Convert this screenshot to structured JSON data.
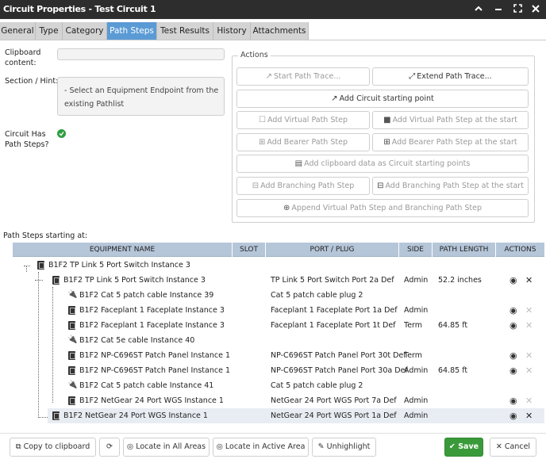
{
  "window": {
    "title": "Circuit Properties - Test Circuit 1",
    "controls": [
      "chevron-up-icon",
      "minimize-icon",
      "expand-icon",
      "close-icon"
    ]
  },
  "tabs": [
    {
      "label": "General",
      "active": false
    },
    {
      "label": "Type",
      "active": false
    },
    {
      "label": "Category",
      "active": false
    },
    {
      "label": "Path Steps",
      "active": true
    },
    {
      "label": "Test Results",
      "active": false
    },
    {
      "label": "History",
      "active": false
    },
    {
      "label": "Attachments",
      "active": false
    }
  ],
  "left": {
    "clipboard_label_1": "Clipboard",
    "clipboard_label_2": "content:",
    "clipboard_value": "",
    "hint_label": "Section / Hint:",
    "hint_text": "- Select an Equipment Endpoint from the existing Pathlist",
    "has_steps_label_1": "Circuit Has",
    "has_steps_label_2": "Path Steps?",
    "has_steps": true
  },
  "actions": {
    "legend": "Actions",
    "start_trace": "Start Path Trace...",
    "extend_trace": "Extend Path Trace...",
    "add_start": "Add Circuit starting point",
    "add_virtual": "Add Virtual Path Step",
    "add_virtual_start": "Add Virtual Path Step at the start",
    "add_bearer": "Add Bearer Path Step",
    "add_bearer_start": "Add Bearer Path Step at the start",
    "add_clipboard": "Add clipboard data as Circuit starting points",
    "add_branching": "Add Branching Path Step",
    "add_branching_start": "Add Branching Path Step at the start",
    "append_virtual_branching": "Append Virtual Path Step and Branching Path Step"
  },
  "path_steps": {
    "label": "Path Steps starting at:",
    "columns": [
      "EQUIPMENT NAME",
      "SLOT",
      "PORT / PLUG",
      "SIDE",
      "PATH LENGTH",
      "ACTIONS"
    ],
    "rows": [
      {
        "name": "B1F2 TP Link 5 Port Switch Instance 3",
        "port": "",
        "side": "",
        "length": "",
        "kind": "equipment",
        "level": 0,
        "actions": false
      },
      {
        "name": "B1F2 TP Link 5 Port Switch Instance 3",
        "port": "TP Link 5 Port Switch Port 2a Def",
        "side": "Admin",
        "length": "52.2 inches",
        "kind": "equipment",
        "level": 1,
        "actions": true,
        "del_enabled": true
      },
      {
        "name": "B1F2 Cat 5 patch cable Instance 39",
        "port": "Cat 5 patch cable plug 2",
        "side": "",
        "length": "",
        "kind": "cable",
        "level": 2,
        "actions": false
      },
      {
        "name": "B1F2 Faceplant 1 Faceplate Instance 3",
        "port": "Faceplant 1 Faceplate Port 1a Def",
        "side": "Admin",
        "length": "",
        "kind": "equipment",
        "level": 2,
        "actions": true,
        "del_enabled": false
      },
      {
        "name": "B1F2 Faceplant 1 Faceplate Instance 3",
        "port": "Faceplant 1 Faceplate Port 1t Def",
        "side": "Term",
        "length": "64.85 ft",
        "kind": "equipment",
        "level": 2,
        "actions": true,
        "del_enabled": false
      },
      {
        "name": "B1F2 Cat 5e cable Instance 40",
        "port": "",
        "side": "",
        "length": "",
        "kind": "cable",
        "level": 2,
        "actions": false
      },
      {
        "name": "B1F2 NP-C696ST Patch Panel Instance 1",
        "port": "NP-C696ST Patch Panel Port 30t Def",
        "side": "Term",
        "length": "",
        "kind": "equipment",
        "level": 2,
        "actions": true,
        "del_enabled": false
      },
      {
        "name": "B1F2 NP-C696ST Patch Panel Instance 1",
        "port": "NP-C696ST Patch Panel Port 30a Def",
        "side": "Admin",
        "length": "64.85 ft",
        "kind": "equipment",
        "level": 2,
        "actions": true,
        "del_enabled": false
      },
      {
        "name": "B1F2 Cat 5 patch cable Instance 41",
        "port": "Cat 5 patch cable plug 2",
        "side": "",
        "length": "",
        "kind": "cable",
        "level": 2,
        "actions": false
      },
      {
        "name": "B1F2 NetGear 24 Port WGS Instance 1",
        "port": "NetGear 24 Port WGS Port 7a Def",
        "side": "Admin",
        "length": "",
        "kind": "equipment",
        "level": 2,
        "actions": true,
        "del_enabled": false
      },
      {
        "name": "B1F2 NetGear 24 Port WGS Instance 1",
        "port": "NetGear 24 Port WGS Port 1a Def",
        "side": "Admin",
        "length": "",
        "kind": "equipment",
        "level": 1,
        "actions": true,
        "del_enabled": true,
        "selected": true
      }
    ]
  },
  "footer": {
    "copy": "Copy to clipboard",
    "locate_all": "Locate in All Areas",
    "locate_active": "Locate in Active Area",
    "unhighlight": "Unhighlight",
    "save": "Save",
    "cancel": "Cancel"
  },
  "colors": {
    "titlebar": "#2d2d2d",
    "active_tab": "#5b9bd5",
    "table_header": "#b6c6d9",
    "save": "#3a9a3a",
    "check": "#2e9e3f"
  }
}
